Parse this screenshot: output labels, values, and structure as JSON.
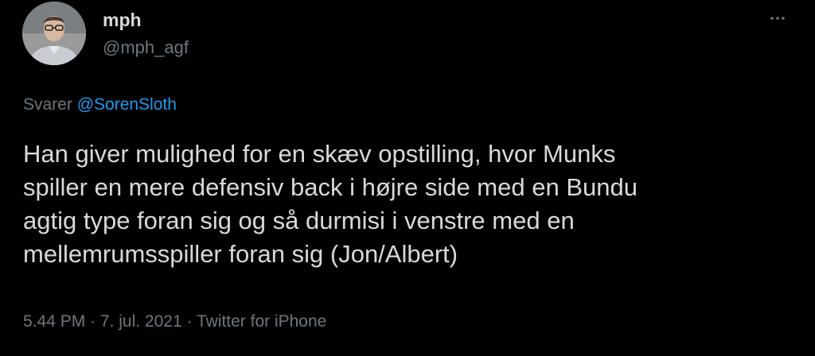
{
  "author": {
    "display_name": "mph",
    "handle": "@mph_agf"
  },
  "icons": {
    "avatar": "profile-photo",
    "more": "more-options-icon"
  },
  "reply": {
    "prefix": "Svarer",
    "mention": "@SorenSloth"
  },
  "tweet": {
    "lines": [
      "Han giver mulighed for en skæv opstilling, hvor Munks",
      "spiller en mere defensiv back i højre side med en Bundu",
      "agtig type foran sig og så durmisi i venstre med en",
      "mellemrumsspiller foran sig (Jon/Albert)"
    ]
  },
  "meta": {
    "time": "5.44 PM",
    "separator1": " · ",
    "date": "7. jul. 2021",
    "separator2": " · ",
    "source": "Twitter for iPhone"
  },
  "colors": {
    "background": "#000000",
    "text": "#d9d9d9",
    "secondary": "#6e767d",
    "link": "#1d9bf0"
  }
}
